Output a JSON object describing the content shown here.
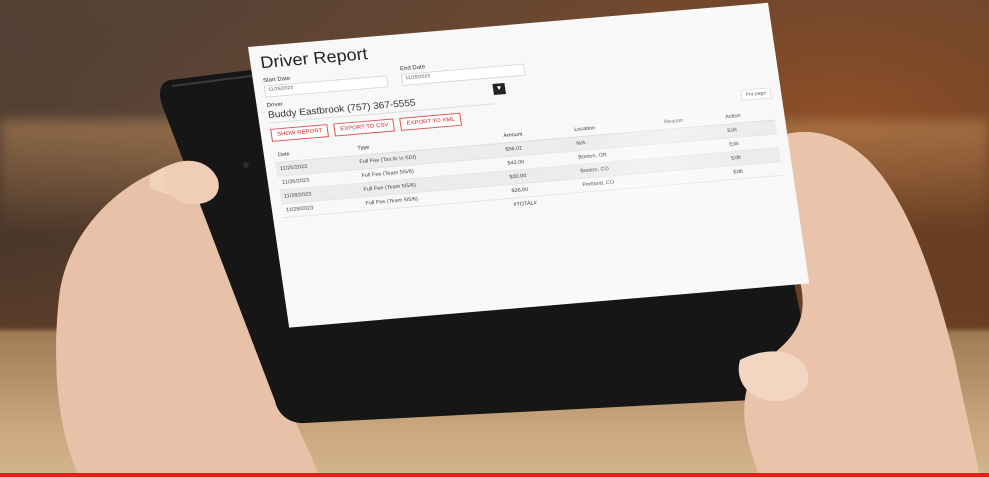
{
  "report": {
    "title": "Driver Report",
    "start_date_label": "Start Date",
    "start_date_value": "11/25/2023",
    "end_date_label": "End Date",
    "end_date_value": "11/29/2023",
    "driver_label": "Driver",
    "driver_value": "Buddy Eastbrook (757) 367-5555",
    "buttons": {
      "show_report": "SHOW REPORT",
      "export_csv": "EXPORT TO CSV",
      "export_xml": "EXPORT TO XML"
    },
    "per_page": "Per page",
    "columns": [
      "Date",
      "Type",
      "Amount",
      "Location",
      "Reason",
      "Action"
    ],
    "rows": [
      {
        "date": "11/25/2023",
        "type": "Full Fee (Tax to ½ SDI)",
        "amount": "$56.01",
        "location": "N/A",
        "reason": "",
        "action": "Edit"
      },
      {
        "date": "11/26/2023",
        "type": "Full Fee (Team 5/5/6)",
        "amount": "$42.00",
        "location": "Boston, OR",
        "reason": "",
        "action": "Edit"
      },
      {
        "date": "11/28/2023",
        "type": "Full Fee (Team 5/5/6)",
        "amount": "$30.00",
        "location": "Boston, CO",
        "reason": "",
        "action": "Edit"
      },
      {
        "date": "11/29/2023",
        "type": "Full Fee (Team 5/5/6)",
        "amount": "$36.00",
        "location": "Portland, CO",
        "reason": "",
        "action": "Edit"
      }
    ],
    "total_label": "#TOTAL#"
  },
  "colors": {
    "accent_red": "#e0201b",
    "button_red": "#d22222",
    "link_blue": "#2b5fb5",
    "tablet_bezel": "#151515"
  }
}
